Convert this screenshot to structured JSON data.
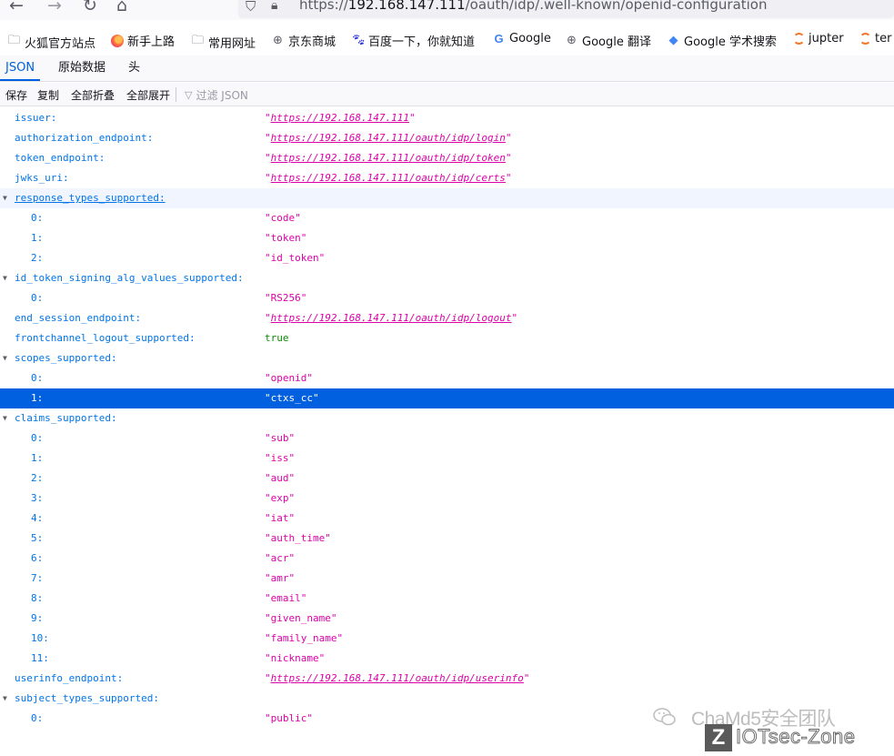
{
  "browser": {
    "nav": {
      "back_icon": "←",
      "forward_icon": "→",
      "reload_icon": "↻",
      "home_icon": "⌂"
    },
    "url": {
      "prefix": "https://",
      "host": "192.168.147.111",
      "path": "/oauth/idp/.well-known/openid-configuration",
      "shield_icon": "shield-icon",
      "lock_icon": "lock-icon"
    },
    "bookmarks": [
      {
        "label": "火狐官方站点",
        "icon": "folder"
      },
      {
        "label": "新手上路",
        "icon": "firefox"
      },
      {
        "label": "常用网址",
        "icon": "folder"
      },
      {
        "label": "京东商城",
        "icon": "globe"
      },
      {
        "label": "百度一下，你就知道",
        "icon": "paw"
      },
      {
        "label": "Google",
        "icon": "google"
      },
      {
        "label": "Google 翻译",
        "icon": "globe"
      },
      {
        "label": "Google 学术搜索",
        "icon": "scholar"
      },
      {
        "label": "jupter",
        "icon": "jupyter"
      },
      {
        "label": "ter",
        "icon": "jupyter"
      }
    ]
  },
  "viewer": {
    "tabs": {
      "json": "JSON",
      "raw": "原始数据",
      "headers": "头"
    },
    "toolbar": {
      "save": "保存",
      "copy": "复制",
      "collapse_all": "全部折叠",
      "expand_all": "全部展开",
      "filter_placeholder": "过滤 JSON"
    }
  },
  "json_rows": [
    {
      "key": "issuer:",
      "value": "\"https://192.168.147.111\"",
      "type": "link",
      "level": 0
    },
    {
      "key": "authorization_endpoint:",
      "value": "\"https://192.168.147.111/oauth/idp/login\"",
      "type": "link",
      "level": 0
    },
    {
      "key": "token_endpoint:",
      "value": "\"https://192.168.147.111/oauth/idp/token\"",
      "type": "link",
      "level": 0
    },
    {
      "key": "jwks_uri:",
      "value": "\"https://192.168.147.111/oauth/idp/certs\"",
      "type": "link",
      "level": 0
    },
    {
      "key": "response_types_supported:",
      "value": "",
      "type": "array",
      "level": 0,
      "highlight": "light",
      "underline": true
    },
    {
      "key": "0:",
      "value": "\"code\"",
      "type": "str",
      "level": 1
    },
    {
      "key": "1:",
      "value": "\"token\"",
      "type": "str",
      "level": 1
    },
    {
      "key": "2:",
      "value": "\"id_token\"",
      "type": "str",
      "level": 1
    },
    {
      "key": "id_token_signing_alg_values_supported:",
      "value": "",
      "type": "array",
      "level": 0
    },
    {
      "key": "0:",
      "value": "\"RS256\"",
      "type": "str",
      "level": 1
    },
    {
      "key": "end_session_endpoint:",
      "value": "\"https://192.168.147.111/oauth/idp/logout\"",
      "type": "link",
      "level": 0
    },
    {
      "key": "frontchannel_logout_supported:",
      "value": "true",
      "type": "bool",
      "level": 0
    },
    {
      "key": "scopes_supported:",
      "value": "",
      "type": "array",
      "level": 0
    },
    {
      "key": "0:",
      "value": "\"openid\"",
      "type": "str",
      "level": 1
    },
    {
      "key": "1:",
      "value": "\"ctxs_cc\"",
      "type": "str",
      "level": 1,
      "highlight": "selected"
    },
    {
      "key": "claims_supported:",
      "value": "",
      "type": "array",
      "level": 0
    },
    {
      "key": "0:",
      "value": "\"sub\"",
      "type": "str",
      "level": 1
    },
    {
      "key": "1:",
      "value": "\"iss\"",
      "type": "str",
      "level": 1
    },
    {
      "key": "2:",
      "value": "\"aud\"",
      "type": "str",
      "level": 1
    },
    {
      "key": "3:",
      "value": "\"exp\"",
      "type": "str",
      "level": 1
    },
    {
      "key": "4:",
      "value": "\"iat\"",
      "type": "str",
      "level": 1
    },
    {
      "key": "5:",
      "value": "\"auth_time\"",
      "type": "str",
      "level": 1
    },
    {
      "key": "6:",
      "value": "\"acr\"",
      "type": "str",
      "level": 1
    },
    {
      "key": "7:",
      "value": "\"amr\"",
      "type": "str",
      "level": 1
    },
    {
      "key": "8:",
      "value": "\"email\"",
      "type": "str",
      "level": 1
    },
    {
      "key": "9:",
      "value": "\"given_name\"",
      "type": "str",
      "level": 1
    },
    {
      "key": "10:",
      "value": "\"family_name\"",
      "type": "str",
      "level": 1
    },
    {
      "key": "11:",
      "value": "\"nickname\"",
      "type": "str",
      "level": 1
    },
    {
      "key": "userinfo_endpoint:",
      "value": "\"https://192.168.147.111/oauth/idp/userinfo\"",
      "type": "link",
      "level": 0
    },
    {
      "key": "subject_types_supported:",
      "value": "",
      "type": "array",
      "level": 0
    },
    {
      "key": "0:",
      "value": "\"public\"",
      "type": "str",
      "level": 1
    }
  ],
  "watermark": {
    "line1": "ChaMd5安全团队",
    "logo_letter": "Z",
    "line2": "IOTsec-Zone"
  },
  "colors": {
    "key": "#0074e8",
    "string": "#dd00a9",
    "bool": "#058b00",
    "selected_row": "#0060df",
    "accent_tab": "#0060df"
  }
}
